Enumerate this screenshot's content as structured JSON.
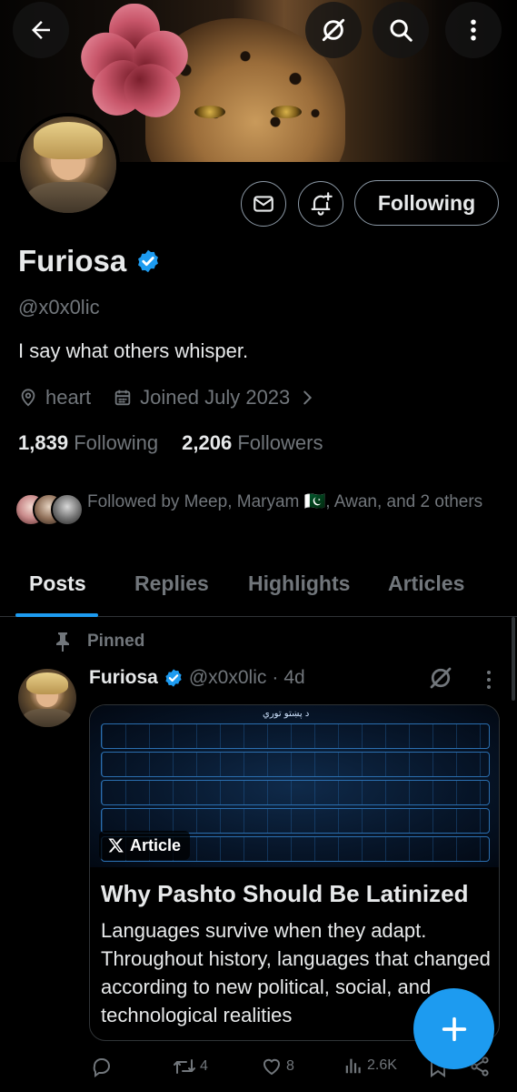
{
  "colors": {
    "accent": "#1d9bf0",
    "muted": "#71767b",
    "text": "#e7e9ea",
    "background": "#000000",
    "border": "#2f3336"
  },
  "header": {
    "back_icon": "arrow-left-icon",
    "grok_icon": "grok-slash-icon",
    "search_icon": "search-icon",
    "more_icon": "more-vertical-icon"
  },
  "profile": {
    "name": "Furiosa",
    "verified": true,
    "handle": "@x0x0lic",
    "bio": "I say what others whisper.",
    "location": "heart",
    "joined": "Joined July 2023",
    "following_count": "1,839",
    "following_label": "Following",
    "followers_count": "2,206",
    "followers_label": "Followers",
    "followed_by": "Followed by Meep, Maryam 🇵🇰, Awan, and 2 others",
    "following_button": "Following"
  },
  "tabs": [
    {
      "label": "Posts",
      "active": true
    },
    {
      "label": "Replies",
      "active": false
    },
    {
      "label": "Highlights",
      "active": false
    },
    {
      "label": "Articles",
      "active": false
    }
  ],
  "post": {
    "pinned_label": "Pinned",
    "author": "Furiosa",
    "handle": "@x0x0lic",
    "separator": "·",
    "time": "4d",
    "card": {
      "image_title": "د پښتو توري",
      "badge": "Article",
      "title": "Why Pashto Should Be Latinized",
      "description": "Languages survive when they adapt. Throughout history, languages that changed according to new political, social, and technological realities"
    },
    "actions": {
      "replies": "",
      "reposts": "4",
      "likes": "8",
      "views": "2.6K"
    }
  }
}
